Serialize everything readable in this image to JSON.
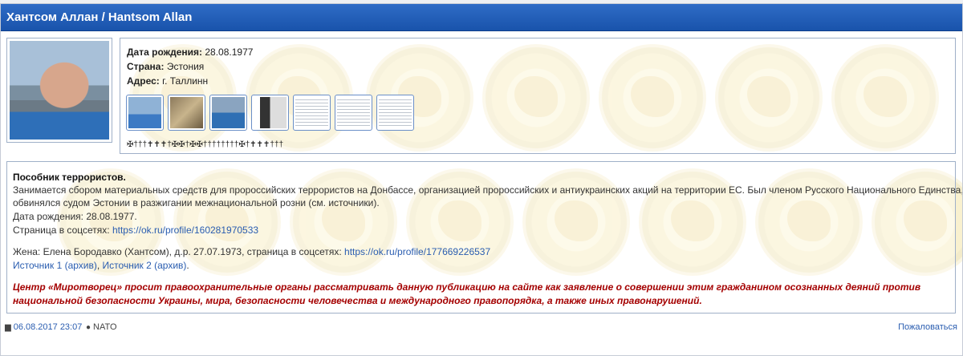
{
  "header": {
    "title": "Хантсом Аллан / Hantsom Allan"
  },
  "info": {
    "birth_label": "Дата рождения:",
    "birth_value": "28.08.1977",
    "country_label": "Страна:",
    "country_value": "Эстония",
    "address_label": "Адрес:",
    "address_value": "г. Таллинн",
    "thumbnails": [
      "photo-1",
      "photo-2",
      "photo-3",
      "photo-4",
      "document-1",
      "document-2",
      "document-3"
    ],
    "crosses": "✠†††✝✝✝†✠✠†✠✠††††††††✠†✝✝✝†††"
  },
  "description": {
    "heading": "Пособник террористов.",
    "line1": "Занимается сбором материальных средств для пророссийских террористов на Донбассе, организацией пророссийских и антиукраинских акций на территории ЕС. Был членом Русского Национального Единства,",
    "line2": "обвинялся судом Эстонии в разжигании межнациональной розни (см. источники).",
    "birth": "Дата рождения: 28.08.1977.",
    "social_label": "Страница в соцсетях:",
    "social_link": "https://ok.ru/profile/160281970533",
    "wife_text": "Жена: Елена Бородавко (Хантсом), д.р. 27.07.1973, страница в соцсетях:",
    "wife_link": "https://ok.ru/profile/177669226537",
    "source1": "Источник 1 (архив)",
    "sep": ",",
    "source2": "Источник 2 (архив)",
    "end": ".",
    "warning1": "Центр «Миротворец» просит правоохранительные органы рассматривать данную публикацию на сайте как заявление о совершении этим гражданином осознанных деяний против",
    "warning2": "национальной безопасности Украины, мира, безопасности человечества и международного правопорядка, а также иных правонарушений."
  },
  "footer": {
    "date_icon": "calendar-icon",
    "date": "06.08.2017 23:07",
    "user_icon": "user-icon",
    "author": "NATO",
    "complain": "Пожаловаться"
  },
  "colors": {
    "header": "#1953ab",
    "link": "#2a5db0",
    "warning": "#a40000"
  }
}
